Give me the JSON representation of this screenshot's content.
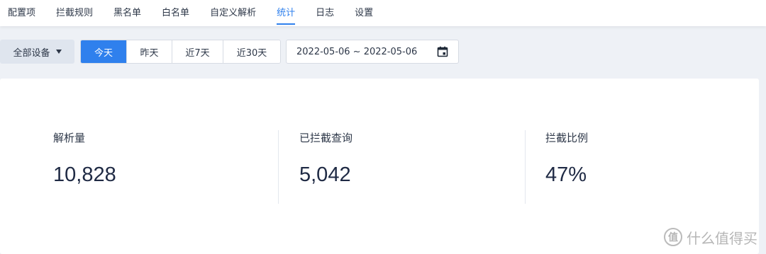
{
  "nav": {
    "tabs": [
      {
        "label": "配置项"
      },
      {
        "label": "拦截规则"
      },
      {
        "label": "黑名单"
      },
      {
        "label": "白名单"
      },
      {
        "label": "自定义解析"
      },
      {
        "label": "统计"
      },
      {
        "label": "日志"
      },
      {
        "label": "设置"
      }
    ],
    "active_tab": "统计",
    "accent_color": "#2f80ed"
  },
  "toolbar": {
    "device_dropdown": "全部设备",
    "range_buttons": [
      {
        "label": "今天",
        "active": true
      },
      {
        "label": "昨天",
        "active": false
      },
      {
        "label": "近7天",
        "active": false
      },
      {
        "label": "近30天",
        "active": false
      }
    ],
    "date_range": "2022-05-06 ~ 2022-05-06",
    "calendar_icon": "calendar-icon"
  },
  "stats": [
    {
      "label": "解析量",
      "value": "10,828"
    },
    {
      "label": "已拦截查询",
      "value": "5,042"
    },
    {
      "label": "拦截比例",
      "value": "47%"
    }
  ],
  "watermark": {
    "logo": "值",
    "text": "什么值得买"
  }
}
